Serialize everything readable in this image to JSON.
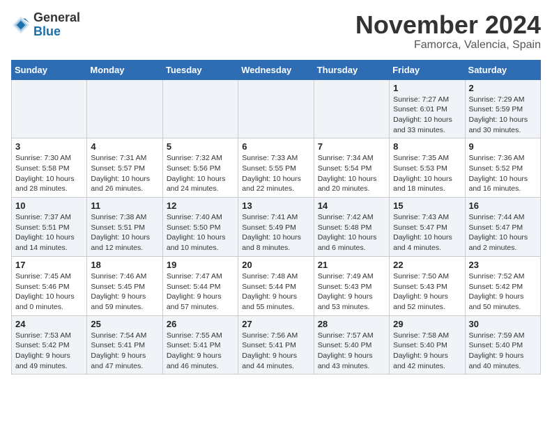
{
  "header": {
    "logo_line1": "General",
    "logo_line2": "Blue",
    "month": "November 2024",
    "location": "Famorca, Valencia, Spain"
  },
  "days_of_week": [
    "Sunday",
    "Monday",
    "Tuesday",
    "Wednesday",
    "Thursday",
    "Friday",
    "Saturday"
  ],
  "weeks": [
    [
      {
        "day": "",
        "info": ""
      },
      {
        "day": "",
        "info": ""
      },
      {
        "day": "",
        "info": ""
      },
      {
        "day": "",
        "info": ""
      },
      {
        "day": "",
        "info": ""
      },
      {
        "day": "1",
        "info": "Sunrise: 7:27 AM\nSunset: 6:01 PM\nDaylight: 10 hours and 33 minutes."
      },
      {
        "day": "2",
        "info": "Sunrise: 7:29 AM\nSunset: 5:59 PM\nDaylight: 10 hours and 30 minutes."
      }
    ],
    [
      {
        "day": "3",
        "info": "Sunrise: 7:30 AM\nSunset: 5:58 PM\nDaylight: 10 hours and 28 minutes."
      },
      {
        "day": "4",
        "info": "Sunrise: 7:31 AM\nSunset: 5:57 PM\nDaylight: 10 hours and 26 minutes."
      },
      {
        "day": "5",
        "info": "Sunrise: 7:32 AM\nSunset: 5:56 PM\nDaylight: 10 hours and 24 minutes."
      },
      {
        "day": "6",
        "info": "Sunrise: 7:33 AM\nSunset: 5:55 PM\nDaylight: 10 hours and 22 minutes."
      },
      {
        "day": "7",
        "info": "Sunrise: 7:34 AM\nSunset: 5:54 PM\nDaylight: 10 hours and 20 minutes."
      },
      {
        "day": "8",
        "info": "Sunrise: 7:35 AM\nSunset: 5:53 PM\nDaylight: 10 hours and 18 minutes."
      },
      {
        "day": "9",
        "info": "Sunrise: 7:36 AM\nSunset: 5:52 PM\nDaylight: 10 hours and 16 minutes."
      }
    ],
    [
      {
        "day": "10",
        "info": "Sunrise: 7:37 AM\nSunset: 5:51 PM\nDaylight: 10 hours and 14 minutes."
      },
      {
        "day": "11",
        "info": "Sunrise: 7:38 AM\nSunset: 5:51 PM\nDaylight: 10 hours and 12 minutes."
      },
      {
        "day": "12",
        "info": "Sunrise: 7:40 AM\nSunset: 5:50 PM\nDaylight: 10 hours and 10 minutes."
      },
      {
        "day": "13",
        "info": "Sunrise: 7:41 AM\nSunset: 5:49 PM\nDaylight: 10 hours and 8 minutes."
      },
      {
        "day": "14",
        "info": "Sunrise: 7:42 AM\nSunset: 5:48 PM\nDaylight: 10 hours and 6 minutes."
      },
      {
        "day": "15",
        "info": "Sunrise: 7:43 AM\nSunset: 5:47 PM\nDaylight: 10 hours and 4 minutes."
      },
      {
        "day": "16",
        "info": "Sunrise: 7:44 AM\nSunset: 5:47 PM\nDaylight: 10 hours and 2 minutes."
      }
    ],
    [
      {
        "day": "17",
        "info": "Sunrise: 7:45 AM\nSunset: 5:46 PM\nDaylight: 10 hours and 0 minutes."
      },
      {
        "day": "18",
        "info": "Sunrise: 7:46 AM\nSunset: 5:45 PM\nDaylight: 9 hours and 59 minutes."
      },
      {
        "day": "19",
        "info": "Sunrise: 7:47 AM\nSunset: 5:44 PM\nDaylight: 9 hours and 57 minutes."
      },
      {
        "day": "20",
        "info": "Sunrise: 7:48 AM\nSunset: 5:44 PM\nDaylight: 9 hours and 55 minutes."
      },
      {
        "day": "21",
        "info": "Sunrise: 7:49 AM\nSunset: 5:43 PM\nDaylight: 9 hours and 53 minutes."
      },
      {
        "day": "22",
        "info": "Sunrise: 7:50 AM\nSunset: 5:43 PM\nDaylight: 9 hours and 52 minutes."
      },
      {
        "day": "23",
        "info": "Sunrise: 7:52 AM\nSunset: 5:42 PM\nDaylight: 9 hours and 50 minutes."
      }
    ],
    [
      {
        "day": "24",
        "info": "Sunrise: 7:53 AM\nSunset: 5:42 PM\nDaylight: 9 hours and 49 minutes."
      },
      {
        "day": "25",
        "info": "Sunrise: 7:54 AM\nSunset: 5:41 PM\nDaylight: 9 hours and 47 minutes."
      },
      {
        "day": "26",
        "info": "Sunrise: 7:55 AM\nSunset: 5:41 PM\nDaylight: 9 hours and 46 minutes."
      },
      {
        "day": "27",
        "info": "Sunrise: 7:56 AM\nSunset: 5:41 PM\nDaylight: 9 hours and 44 minutes."
      },
      {
        "day": "28",
        "info": "Sunrise: 7:57 AM\nSunset: 5:40 PM\nDaylight: 9 hours and 43 minutes."
      },
      {
        "day": "29",
        "info": "Sunrise: 7:58 AM\nSunset: 5:40 PM\nDaylight: 9 hours and 42 minutes."
      },
      {
        "day": "30",
        "info": "Sunrise: 7:59 AM\nSunset: 5:40 PM\nDaylight: 9 hours and 40 minutes."
      }
    ]
  ]
}
